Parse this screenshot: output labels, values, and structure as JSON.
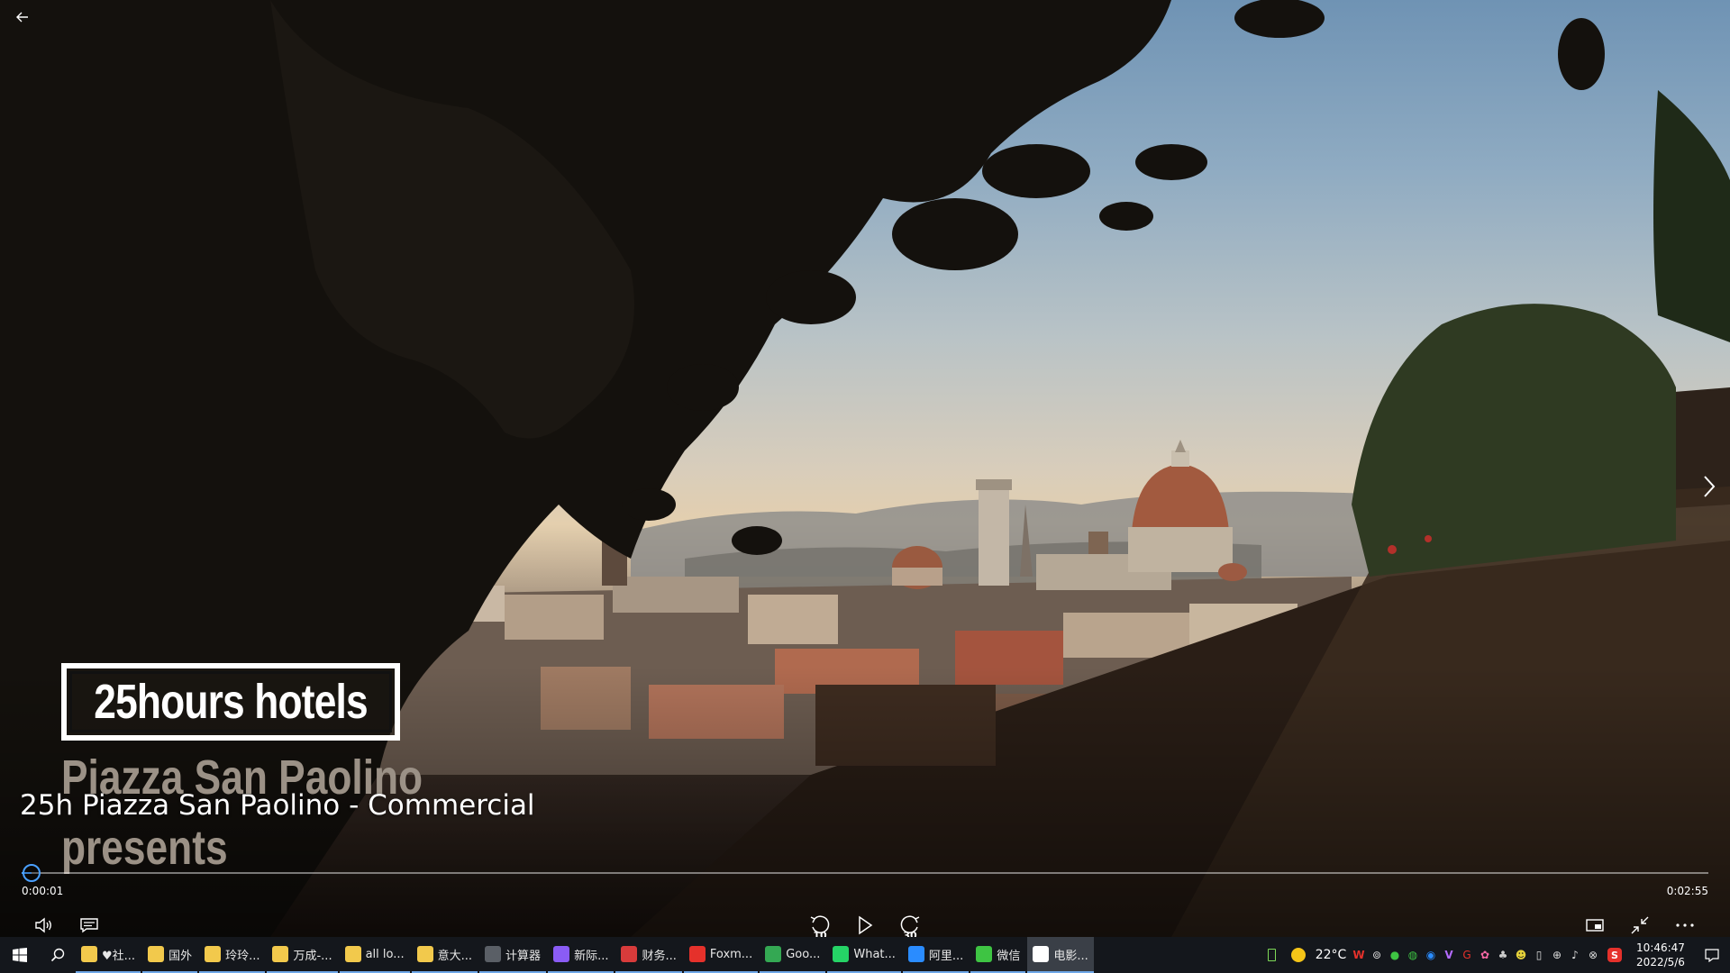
{
  "player": {
    "media_title": "25h Piazza San Paolino - Commercial",
    "current_time": "0:00:01",
    "duration": "0:02:55",
    "progress": 0.006,
    "skip_back_label": "10",
    "skip_forward_label": "30"
  },
  "video_frame": {
    "brand": "25hours hotels",
    "line1": "Piazza San Paolino",
    "line2": "presents"
  },
  "taskbar": {
    "apps": [
      {
        "label": "♥社...",
        "icon": "folder-icon",
        "color": "#f2c94c"
      },
      {
        "label": "国外",
        "icon": "folder-icon",
        "color": "#f2c94c"
      },
      {
        "label": "玲玲...",
        "icon": "folder-icon",
        "color": "#f2c94c"
      },
      {
        "label": "万成-...",
        "icon": "folder-icon",
        "color": "#f2c94c"
      },
      {
        "label": "all lo...",
        "icon": "folder-icon",
        "color": "#f2c94c"
      },
      {
        "label": "意大...",
        "icon": "folder-icon",
        "color": "#f2c94c"
      },
      {
        "label": "计算器",
        "icon": "calculator-icon",
        "color": "#5a5f66"
      },
      {
        "label": "新际...",
        "icon": "browser-icon",
        "color": "#8a5cf5"
      },
      {
        "label": "财务...",
        "icon": "finance-icon",
        "color": "#d83b3b"
      },
      {
        "label": "Foxm...",
        "icon": "foxmail-icon",
        "color": "#e5312b"
      },
      {
        "label": "Goo...",
        "icon": "chrome-icon",
        "color": "#34a853"
      },
      {
        "label": "What...",
        "icon": "whatsapp-icon",
        "color": "#25d366"
      },
      {
        "label": "阿里...",
        "icon": "aliwangwang-icon",
        "color": "#2a8cff"
      },
      {
        "label": "微信",
        "icon": "wechat-icon",
        "color": "#3ec443"
      },
      {
        "label": "电影...",
        "icon": "movies-icon",
        "color": "#ffffff"
      }
    ],
    "weather": "22°C",
    "time": "10:46:47",
    "date": "2022/5/6"
  }
}
